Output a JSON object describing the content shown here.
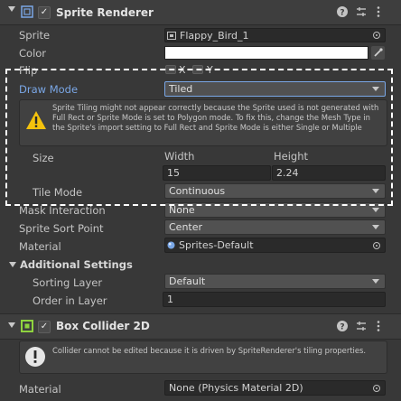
{
  "sprite_renderer": {
    "title": "Sprite Renderer",
    "enabled_check": "✓",
    "sprite_label": "Sprite",
    "sprite_value": "Flappy_Bird_1",
    "color_label": "Color",
    "color_value": "#ffffff",
    "flip_label": "Flip",
    "flip_x": "X",
    "flip_y": "Y",
    "draw_mode_label": "Draw Mode",
    "draw_mode_value": "Tiled",
    "tiling_warning": "Sprite Tiling might not appear correctly because the Sprite used is not generated with Full Rect or Sprite Mode is set to Polygon mode. To fix this, change the Mesh Type in the Sprite's import setting to Full Rect and Sprite Mode is either Single or Multiple",
    "size_label": "Size",
    "width_label": "Width",
    "height_label": "Height",
    "width_value": "15",
    "height_value": "2.24",
    "tile_mode_label": "Tile Mode",
    "tile_mode_value": "Continuous",
    "mask_label": "Mask Interaction",
    "mask_value": "None",
    "sort_point_label": "Sprite Sort Point",
    "sort_point_value": "Center",
    "material_label": "Material",
    "material_value": "Sprites-Default"
  },
  "additional_settings": {
    "title": "Additional Settings",
    "sorting_layer_label": "Sorting Layer",
    "sorting_layer_value": "Default",
    "order_label": "Order in Layer",
    "order_value": "1"
  },
  "box_collider": {
    "title": "Box Collider 2D",
    "enabled_check": "✓",
    "info": "Collider cannot be edited because it is driven by SpriteRenderer's tiling properties.",
    "material_label": "Material",
    "material_value": "None (Physics Material 2D)"
  },
  "colors": {
    "accent_blue": "#7aa7e6",
    "warning_yellow": "#f4c20d",
    "collider_green": "#8fd33f",
    "highlight_dashed": "#ffffff"
  }
}
